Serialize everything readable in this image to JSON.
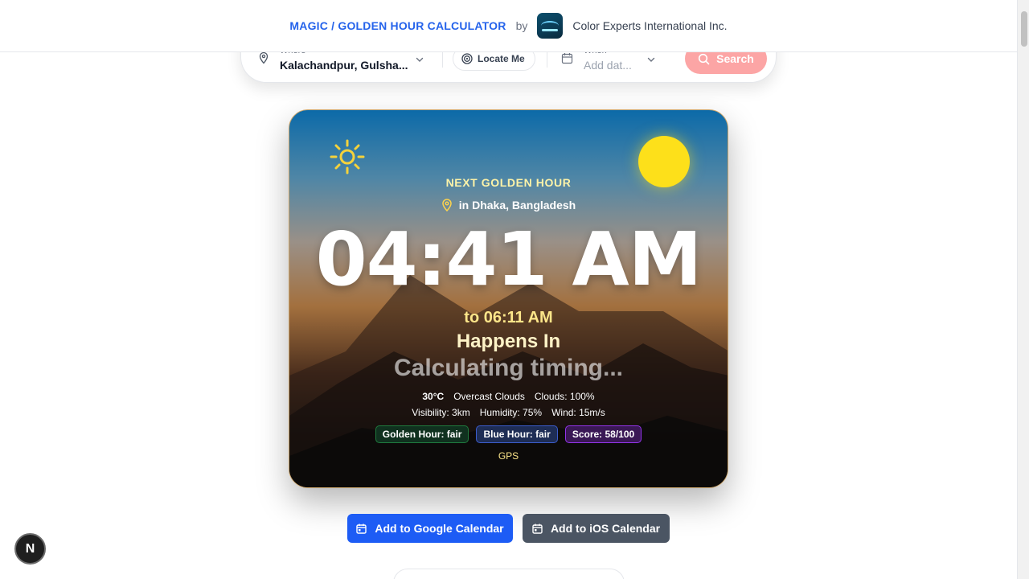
{
  "header": {
    "title": "MAGIC / GOLDEN HOUR CALCULATOR",
    "by": "by",
    "company": "Color Experts International Inc."
  },
  "search": {
    "where_label": "Where",
    "where_value": "Kalachandpur, Gulsha...",
    "locate_label": "Locate Me",
    "when_label": "When",
    "when_placeholder": "Add dat...",
    "search_label": "Search",
    "search_color": "#fca5a5"
  },
  "card": {
    "next_label": "NEXT GOLDEN HOUR",
    "location": "in Dhaka, Bangladesh",
    "time": "04:41 AM",
    "to_time": "to 06:11 AM",
    "happens_in": "Happens In",
    "countdown": "Calculating timing...",
    "weather": {
      "temperature": "30°C",
      "condition": "Overcast Clouds",
      "clouds": "Clouds: 100%",
      "visibility": "Visibility: 3km",
      "humidity": "Humidity: 75%",
      "wind": "Wind: 15m/s"
    },
    "badges": {
      "golden": "Golden Hour: fair",
      "blue": "Blue Hour: fair",
      "score": "Score: 58/100"
    },
    "source": "GPS"
  },
  "actions": {
    "google_calendar": "Add to Google Calendar",
    "ios_calendar": "Add to iOS Calendar",
    "google_color": "#1d5cf5",
    "ios_color": "#4b5563"
  },
  "floating": {
    "badge_letter": "N"
  }
}
